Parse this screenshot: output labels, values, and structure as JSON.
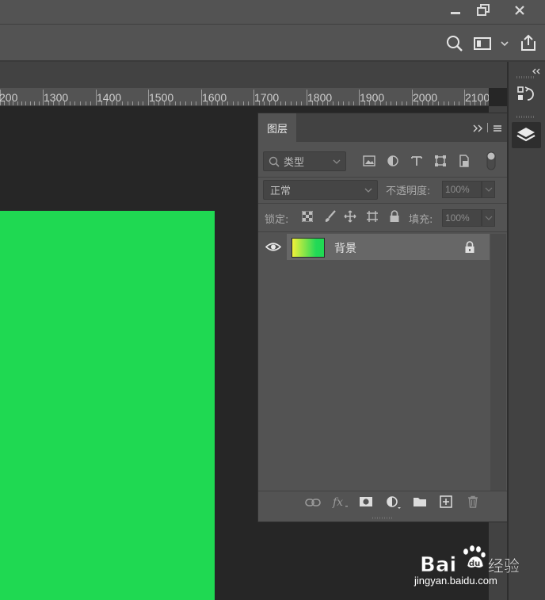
{
  "window_controls": {
    "minimize_icon": "minimize-icon",
    "restore_icon": "restore-icon",
    "close_icon": "close-icon"
  },
  "options_bar": {
    "search_icon": "search-icon",
    "workspace_icon": "workspace-icon",
    "share_icon": "share-icon"
  },
  "ruler": {
    "labels": [
      "200",
      "1300",
      "1400",
      "1500",
      "1600",
      "1700",
      "1800",
      "1900",
      "2000",
      "2100"
    ]
  },
  "layers_panel": {
    "tab_label": "图层",
    "filter": {
      "kind_label": "类型"
    },
    "blend_mode": "正常",
    "opacity_label": "不透明度:",
    "opacity_value": "100%",
    "lock_label": "锁定:",
    "fill_label": "填充:",
    "fill_value": "100%",
    "layers": [
      {
        "name": "背景",
        "visible": true,
        "locked": true
      }
    ]
  },
  "colors": {
    "canvas_green": "#1fd952",
    "panel_bg": "#535353",
    "doc_bg": "#262626"
  },
  "watermark": {
    "brand": "Bai 经验",
    "url": "jingyan.baidu.com"
  }
}
